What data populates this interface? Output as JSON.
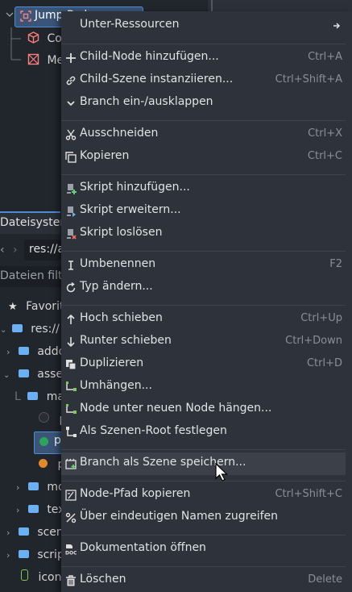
{
  "scene_tree": {
    "root": "Jump Pad",
    "children": [
      "Co",
      "Me"
    ]
  },
  "filesystem": {
    "tab": "Dateisystem",
    "path": "res://a",
    "filter_placeholder": "Dateien filte",
    "items": [
      {
        "label": "Favorit",
        "icon": "star-icon"
      },
      {
        "label": "res://",
        "icon": "folder-icon"
      },
      {
        "label": "addo",
        "icon": "folder-icon"
      },
      {
        "label": "asse",
        "icon": "folder-icon"
      },
      {
        "label": "ma",
        "icon": "folder-icon"
      },
      {
        "label": "p",
        "icon": "sphere-icon"
      },
      {
        "label": "p",
        "icon": "sphere-icon"
      },
      {
        "label": "p",
        "icon": "sphere-icon"
      },
      {
        "label": "mo",
        "icon": "folder-icon"
      },
      {
        "label": "tex",
        "icon": "folder-icon"
      },
      {
        "label": "scen",
        "icon": "folder-icon"
      },
      {
        "label": "scrip",
        "icon": "folder-icon"
      },
      {
        "label": "icon.",
        "icon": "file-icon"
      }
    ]
  },
  "menu": {
    "items": [
      {
        "label": "Unter-Ressourcen",
        "shortcut": "",
        "icon": "submenu-arrow-icon"
      },
      {
        "label": "Child-Node hinzufügen...",
        "shortcut": "Ctrl+A",
        "icon": "plus-icon"
      },
      {
        "label": "Child-Szene instanziieren...",
        "shortcut": "Ctrl+Shift+A",
        "icon": "link-icon"
      },
      {
        "label": "Branch ein-/ausklappen",
        "shortcut": "",
        "icon": "chevron-down-icon"
      },
      {
        "label": "Ausschneiden",
        "shortcut": "Ctrl+X",
        "icon": "scissors-icon"
      },
      {
        "label": "Kopieren",
        "shortcut": "Ctrl+C",
        "icon": "copy-icon"
      },
      {
        "label": "Skript hinzufügen...",
        "shortcut": "",
        "icon": "script-add-icon"
      },
      {
        "label": "Skript erweitern...",
        "shortcut": "",
        "icon": "script-extend-icon"
      },
      {
        "label": "Skript loslösen",
        "shortcut": "",
        "icon": "script-remove-icon"
      },
      {
        "label": "Umbenennen",
        "shortcut": "F2",
        "icon": "rename-icon"
      },
      {
        "label": "Typ ändern...",
        "shortcut": "",
        "icon": "rotate-icon"
      },
      {
        "label": "Hoch schieben",
        "shortcut": "Ctrl+Up",
        "icon": "arrow-up-icon"
      },
      {
        "label": "Runter schieben",
        "shortcut": "Ctrl+Down",
        "icon": "arrow-down-icon"
      },
      {
        "label": "Duplizieren",
        "shortcut": "Ctrl+D",
        "icon": "duplicate-icon"
      },
      {
        "label": "Umhängen...",
        "shortcut": "",
        "icon": "reparent-icon"
      },
      {
        "label": "Node unter neuen Node hängen...",
        "shortcut": "",
        "icon": "reparent-new-icon"
      },
      {
        "label": "Als Szenen-Root festlegen",
        "shortcut": "",
        "icon": "make-root-icon"
      },
      {
        "label": "Branch als Szene speichern...",
        "shortcut": "",
        "icon": "save-branch-icon"
      },
      {
        "label": "Node-Pfad kopieren",
        "shortcut": "Ctrl+Shift+C",
        "icon": "copy-path-icon"
      },
      {
        "label": "Über eindeutigen Namen zugreifen",
        "shortcut": "",
        "icon": "percent-icon"
      },
      {
        "label": "Dokumentation öffnen",
        "shortcut": "",
        "icon": "doc-icon"
      },
      {
        "label": "Löschen",
        "shortcut": "Delete",
        "icon": "trash-icon"
      }
    ]
  },
  "colors": {
    "menu_bg": "#2e323a",
    "hover": "#3b4049",
    "accent": "#4f8ad5"
  }
}
